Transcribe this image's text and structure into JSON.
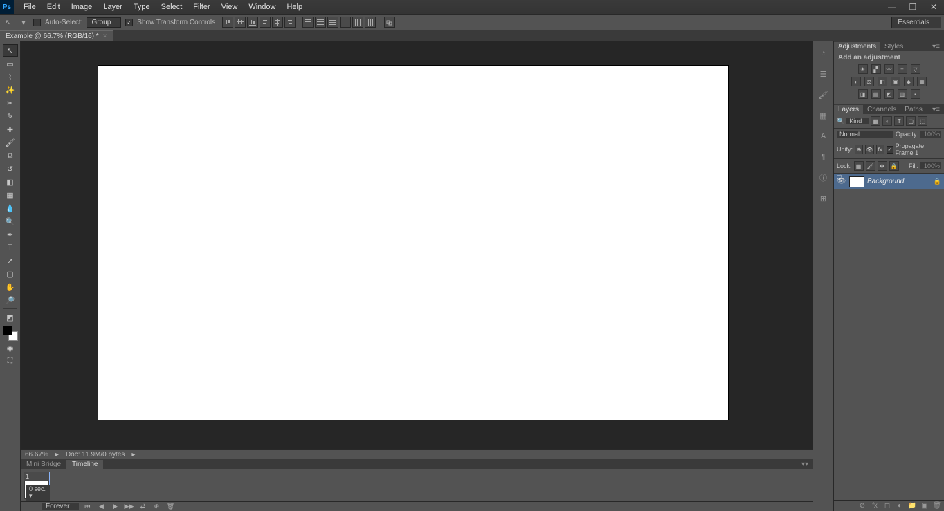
{
  "menu": {
    "file": "File",
    "edit": "Edit",
    "image": "Image",
    "layer": "Layer",
    "type": "Type",
    "select": "Select",
    "filter": "Filter",
    "view": "View",
    "window": "Window",
    "help": "Help"
  },
  "options": {
    "autoSelectLabel": "Auto-Select:",
    "groupSelect": "Group",
    "showTransform": "Show Transform Controls"
  },
  "workspace": "Essentials",
  "docTab": "Example @ 66.7% (RGB/16) *",
  "status": {
    "zoom": "66.67%",
    "docInfo": "Doc: 11.9M/0 bytes"
  },
  "bottomTabs": {
    "mini": "Mini Bridge",
    "timeline": "Timeline"
  },
  "timeline": {
    "frameNum": "1",
    "frameDuration": "0 sec. ▾",
    "loop": "Forever"
  },
  "adjPanel": {
    "tabAdj": "Adjustments",
    "tabStyles": "Styles",
    "title": "Add an adjustment"
  },
  "layersPanel": {
    "tabLayers": "Layers",
    "tabChannels": "Channels",
    "tabPaths": "Paths",
    "kind": "Kind",
    "blend": "Normal",
    "opacityLabel": "Opacity:",
    "opacityVal": "100%",
    "unifyLabel": "Unify:",
    "propagate": "Propagate Frame 1",
    "lockLabel": "Lock:",
    "fillLabel": "Fill:",
    "fillVal": "100%",
    "bgLayer": "Background"
  }
}
